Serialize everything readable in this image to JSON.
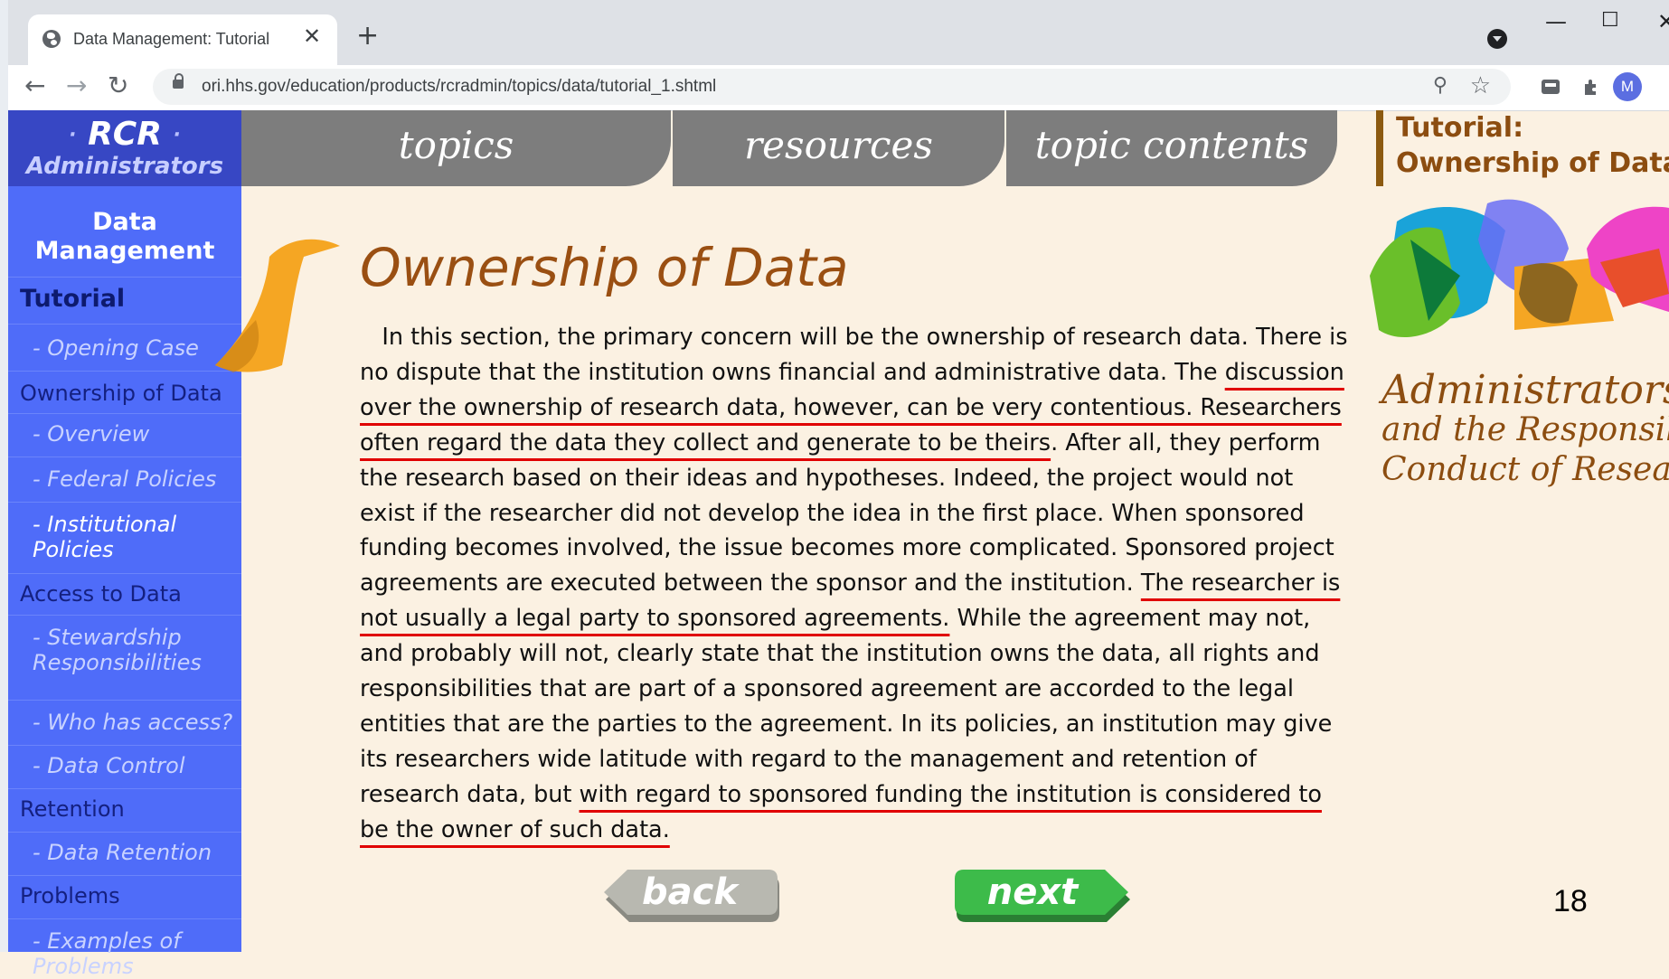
{
  "browser": {
    "tab_title": "Data Management: Tutorial",
    "tab_close": "✕",
    "new_tab": "+",
    "url": "ori.hhs.gov/education/products/rcradmin/topics/data/tutorial_1.shtml",
    "profile_initial": "M",
    "window_controls": {
      "minimize": "—",
      "maximize": "☐",
      "close": "✕"
    },
    "nav": {
      "back": "←",
      "forward": "→",
      "reload": "↻"
    }
  },
  "logo": {
    "dot": "·",
    "rcr": "RCR",
    "administrators": "Administrators"
  },
  "topnav": [
    "topics",
    "resources",
    "topic contents"
  ],
  "sidebar": {
    "heading": "Data Management",
    "items": [
      {
        "label": "Tutorial",
        "kind": "section-bold"
      },
      {
        "label": "- Opening Case",
        "kind": "sub"
      },
      {
        "label": "Ownership of Data",
        "kind": "section"
      },
      {
        "label": "- Overview",
        "kind": "sub"
      },
      {
        "label": "- Federal Policies",
        "kind": "sub"
      },
      {
        "label": "- Institutional Policies",
        "kind": "sub-current"
      },
      {
        "label": "Access to Data",
        "kind": "section"
      },
      {
        "label": "- Stewardship Responsibilities",
        "kind": "sub"
      },
      {
        "label": "- Who has access?",
        "kind": "sub"
      },
      {
        "label": "- Data Control",
        "kind": "sub"
      },
      {
        "label": "Retention",
        "kind": "section"
      },
      {
        "label": "- Data Retention",
        "kind": "sub"
      },
      {
        "label": "Problems",
        "kind": "section"
      },
      {
        "label": "- Examples of Problems",
        "kind": "sub"
      }
    ]
  },
  "main": {
    "title": "Ownership of Data",
    "paragraph": [
      {
        "text": "   In this section, the primary concern will be the ownership of research data. There is no dispute that the institution owns financial and administrative data. The ",
        "underline": false
      },
      {
        "text": "discussion over the ownership of research data, however, can be very contentious. Researchers often regard the data they collect and generate to be theirs",
        "underline": true
      },
      {
        "text": ". After all, they perform the research based on their ideas and hypotheses. Indeed, the project would not exist if the researcher did not develop the idea in the first place. When sponsored funding becomes involved, the issue becomes more complicated. Sponsored project agreements are executed between the sponsor and the institution. ",
        "underline": false
      },
      {
        "text": "The researcher is not usually a legal party to sponsored agreements.",
        "underline": true
      },
      {
        "text": " While the agreement may not, and probably will not, clearly state that the institution owns the data, all rights and responsibilities that are part of a sponsored agreement are accorded to the legal entities that are the parties to the agreement. In its policies, an institution may give its researchers wide latitude with regard to the management and retention of research data, but ",
        "underline": false
      },
      {
        "text": "with regard to sponsored funding the institution is considered to be the owner of such data.",
        "underline": true
      }
    ],
    "back_label": "back",
    "next_label": "next",
    "page_number": "18"
  },
  "right_panel": {
    "tutorial_label": "Tutorial:",
    "tutorial_topic": "Ownership of Data",
    "script_line1": "Administrators",
    "script_line2": "and the Responsible",
    "script_line3": "Conduct of Research"
  },
  "colors": {
    "page_bg": "#fbf1e2",
    "sidebar_bg": "#4f6cf9",
    "logo_bg": "#3747c4",
    "nav_tab_bg": "#7d7d7d",
    "title_brown": "#9a4f12",
    "underline_red": "#e00000",
    "next_green": "#3dbb4a",
    "back_gray": "#b8b8b0"
  }
}
